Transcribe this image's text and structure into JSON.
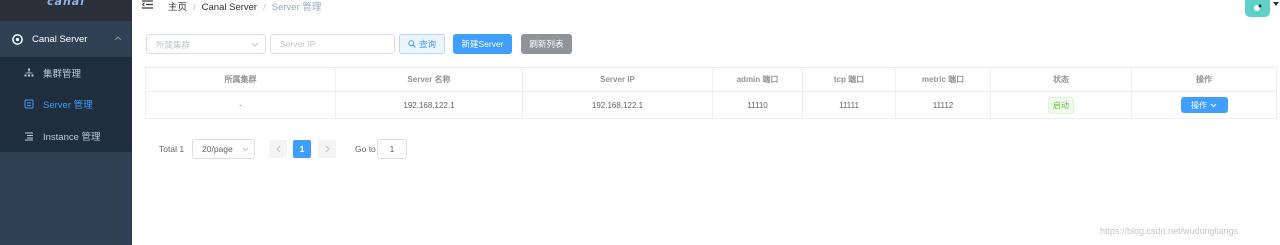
{
  "sidebar": {
    "logo": "canal",
    "menu_title": "Canal Server",
    "items": [
      {
        "label": "集群管理",
        "icon": "cluster-icon"
      },
      {
        "label": "Server 管理",
        "icon": "server-icon"
      },
      {
        "label": "Instance 管理",
        "icon": "instance-icon"
      }
    ]
  },
  "breadcrumb": {
    "home": "主页",
    "section": "Canal Server",
    "current": "Server 管理",
    "separator": "/"
  },
  "filters": {
    "cluster_placeholder": "所属集群",
    "ip_placeholder": "Server IP",
    "search_label": "查询",
    "new_label": "新建Server",
    "refresh_label": "刷新列表"
  },
  "table": {
    "headers": [
      "所属集群",
      "Server 名称",
      "Server IP",
      "admin 端口",
      "tcp 端口",
      "metric 端口",
      "状态",
      "操作"
    ],
    "rows": [
      {
        "cluster": "-",
        "name": "192.168.122.1",
        "ip": "192.168.122.1",
        "admin_port": "11110",
        "tcp_port": "11111",
        "metric_port": "11112",
        "status": "启动",
        "action": "操作"
      }
    ]
  },
  "pagination": {
    "total": "Total 1",
    "page_size": "20/page",
    "current_page": "1",
    "goto_label": "Go to",
    "goto_value": "1"
  },
  "watermark": "https://blog.csdn.net/wudongliangs",
  "colors": {
    "sidebar_bg": "#304156",
    "submenu_bg": "#1f2d3d",
    "primary": "#409eff",
    "info": "#909399",
    "success": "#67c23a"
  }
}
